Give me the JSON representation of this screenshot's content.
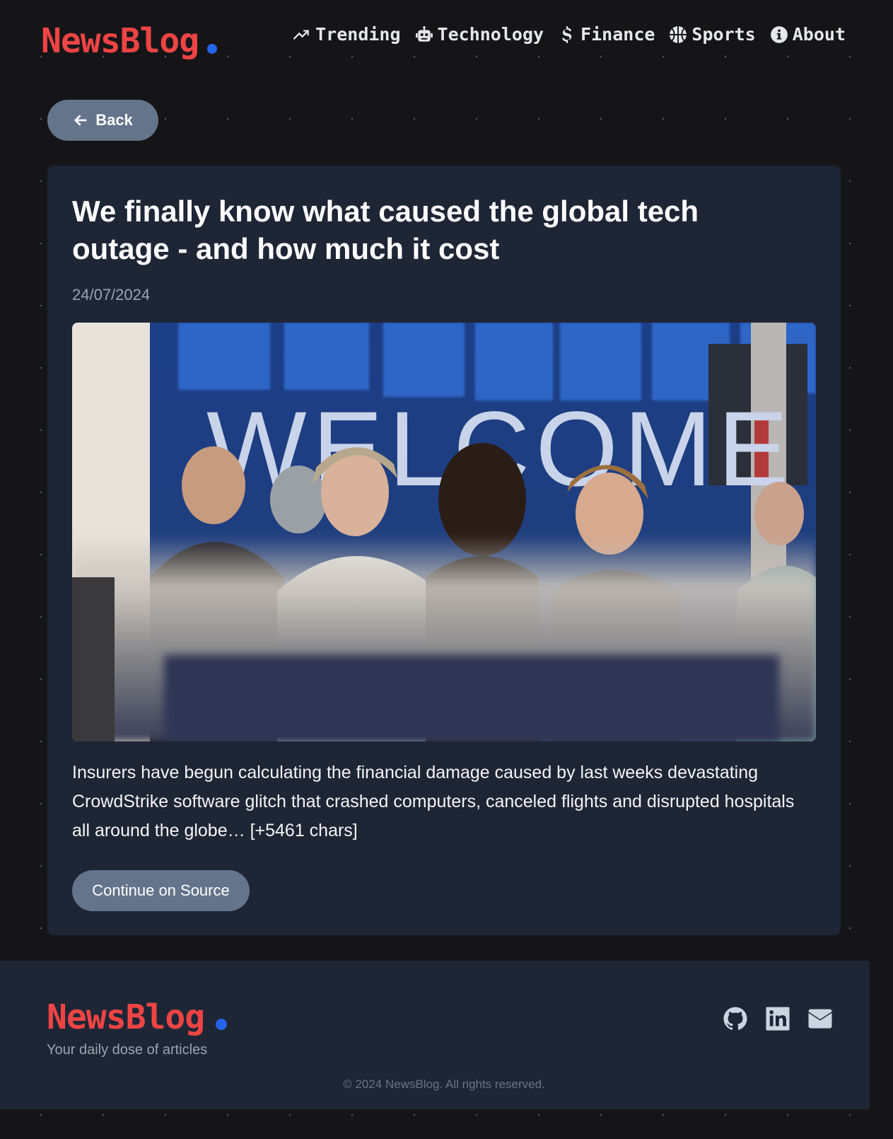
{
  "header": {
    "logo": "NewsBlog",
    "nav": [
      {
        "label": "Trending",
        "icon": "trending-icon"
      },
      {
        "label": "Technology",
        "icon": "robot-icon"
      },
      {
        "label": "Finance",
        "icon": "dollar-icon"
      },
      {
        "label": "Sports",
        "icon": "basketball-icon"
      },
      {
        "label": "About",
        "icon": "info-icon"
      }
    ]
  },
  "back_button": {
    "label": "Back",
    "icon": "arrow-left-icon"
  },
  "article": {
    "title": "We finally know what caused the global tech outage - and how much it cost",
    "date": "24/07/2024",
    "summary": "Insurers have begun calculating the financial damage caused by last weeks devastating CrowdStrike software glitch that crashed computers, canceled flights and disrupted hospitals all around the globe… [+5461 chars]",
    "source_button": "Continue on Source",
    "image_sign_text": "WELCOME A"
  },
  "footer": {
    "logo": "NewsBlog",
    "tagline": "Your daily dose of articles",
    "socials": [
      "github-icon",
      "linkedin-icon",
      "envelope-icon"
    ],
    "copyright": "© 2024 NewsBlog. All rights reserved."
  },
  "colors": {
    "brand": "#ef4444",
    "accent_dot": "#2563eb",
    "background": "#151518",
    "card": "#1e2635",
    "button": "#64748b"
  }
}
